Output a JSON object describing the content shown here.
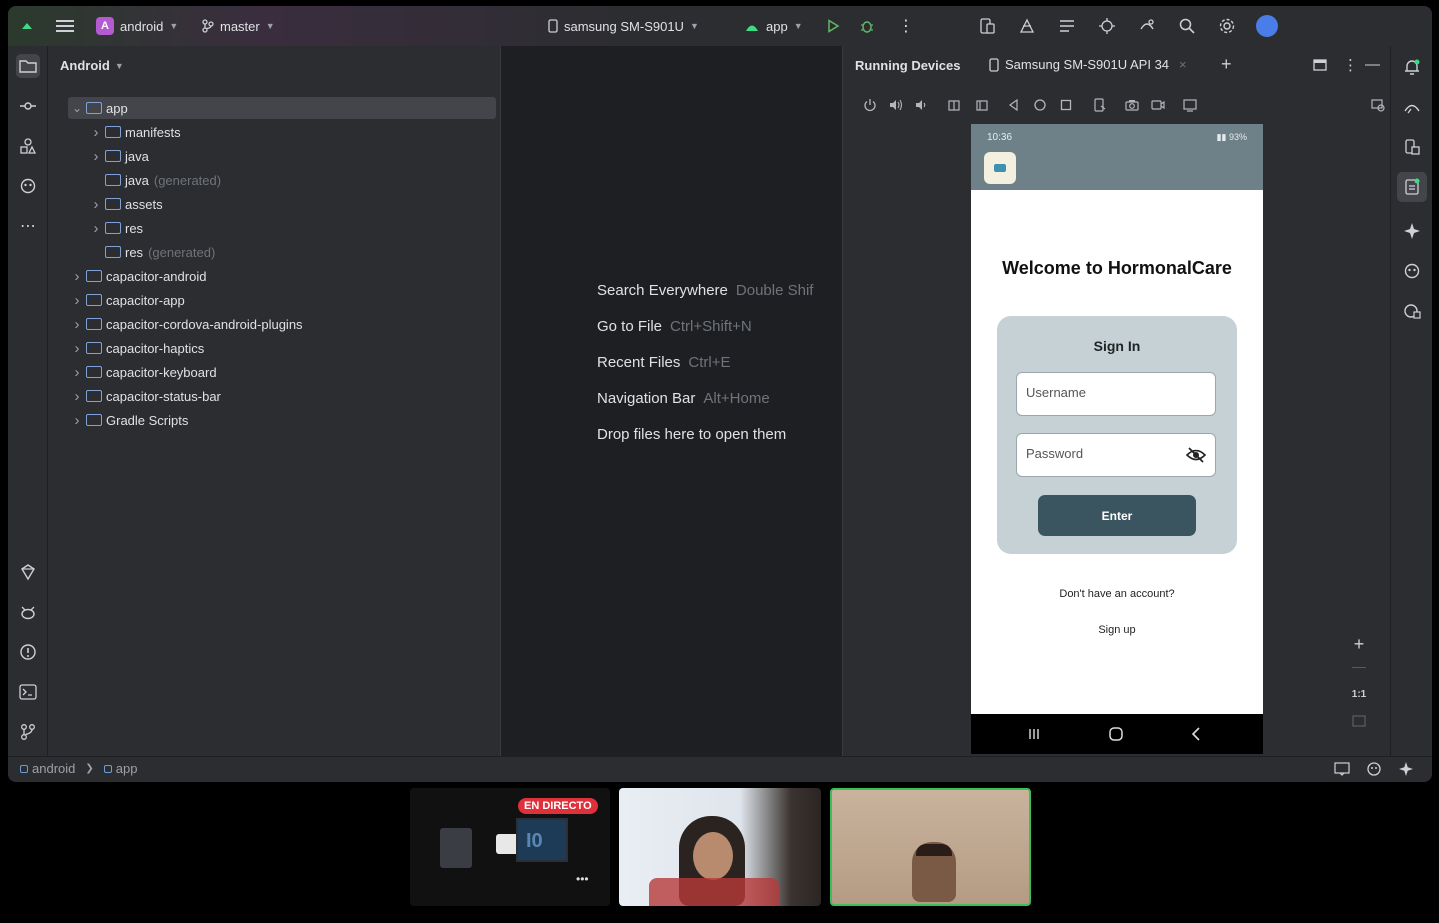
{
  "titlebar": {
    "project_initial": "A",
    "project_name": "android",
    "branch": "master",
    "device": "samsung SM-S901U",
    "run_config": "app"
  },
  "project_panel": {
    "view_mode": "Android",
    "tree": [
      {
        "label": "app",
        "suffix": "",
        "level": 0,
        "expanded": true,
        "selected": true
      },
      {
        "label": "manifests",
        "suffix": "",
        "level": 1,
        "expanded": false
      },
      {
        "label": "java",
        "suffix": "",
        "level": 1,
        "expanded": false
      },
      {
        "label": "java",
        "suffix": "(generated)",
        "level": 1,
        "expanded": false
      },
      {
        "label": "assets",
        "suffix": "",
        "level": 1,
        "expanded": false
      },
      {
        "label": "res",
        "suffix": "",
        "level": 1,
        "expanded": false
      },
      {
        "label": "res",
        "suffix": "(generated)",
        "level": 1,
        "expanded": false
      },
      {
        "label": "capacitor-android",
        "suffix": "",
        "level": 0,
        "expanded": false
      },
      {
        "label": "capacitor-app",
        "suffix": "",
        "level": 0,
        "expanded": false
      },
      {
        "label": "capacitor-cordova-android-plugins",
        "suffix": "",
        "level": 0,
        "expanded": false
      },
      {
        "label": "capacitor-haptics",
        "suffix": "",
        "level": 0,
        "expanded": false
      },
      {
        "label": "capacitor-keyboard",
        "suffix": "",
        "level": 0,
        "expanded": false
      },
      {
        "label": "capacitor-status-bar",
        "suffix": "",
        "level": 0,
        "expanded": false
      },
      {
        "label": "Gradle Scripts",
        "suffix": "",
        "level": 0,
        "expanded": false
      }
    ]
  },
  "editor_hints": [
    {
      "label": "Search Everywhere",
      "key": "Double Shif"
    },
    {
      "label": "Go to File",
      "key": "Ctrl+Shift+N"
    },
    {
      "label": "Recent Files",
      "key": "Ctrl+E"
    },
    {
      "label": "Navigation Bar",
      "key": "Alt+Home"
    },
    {
      "label": "Drop files here to open them",
      "key": ""
    }
  ],
  "running_devices": {
    "title": "Running Devices",
    "tab": "Samsung SM-S901U API 34",
    "zoom_label": "1:1"
  },
  "phone": {
    "time": "10:36",
    "battery": "93%",
    "welcome": "Welcome to HormonalCare",
    "signin_title": "Sign In",
    "username_placeholder": "Username",
    "password_placeholder": "Password",
    "enter_label": "Enter",
    "no_account": "Don't have an account?",
    "signup": "Sign up"
  },
  "statusbar": {
    "crumb_1": "android",
    "crumb_2": "app"
  },
  "video_call": {
    "live_badge": "EN DIRECTO",
    "more": "•••"
  },
  "colors": {
    "ide_bg": "#1e1f22",
    "panel_bg": "#2b2d30",
    "phone_header": "#6e8189",
    "login_card": "#c5d1d4",
    "enter_button": "#3a555f",
    "live_red": "#e0303a",
    "active_tile_border": "#3bbf5c"
  }
}
